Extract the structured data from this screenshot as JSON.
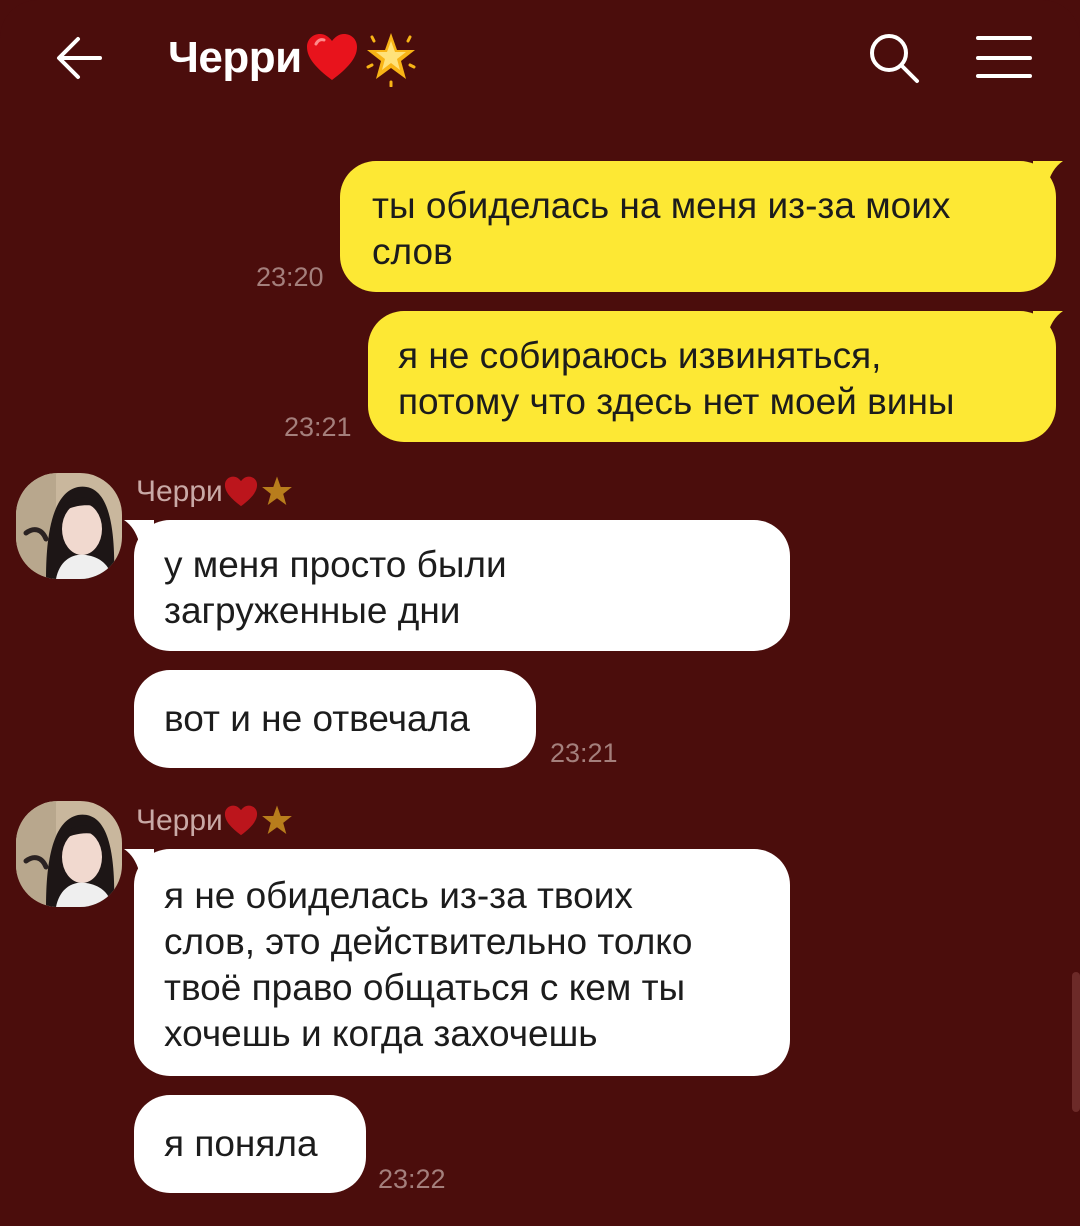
{
  "header": {
    "title": "Черри",
    "title_emoji": [
      "heart-emoji",
      "star-emoji"
    ],
    "back_icon": "arrow-left-icon",
    "search_icon": "search-icon",
    "menu_icon": "hamburger-menu-icon"
  },
  "colors": {
    "background": "#4b0d0c",
    "my_bubble": "#fde834",
    "their_bubble": "#ffffff",
    "timestamp": "#a47f7c"
  },
  "messages": [
    {
      "from": "me",
      "text_lines": [
        "ты обиделась на меня из-за моих",
        "слов"
      ],
      "time": "23:20"
    },
    {
      "from": "me",
      "text_lines": [
        "я не собираюсь извиняться,",
        "потому что здесь нет моей вины"
      ],
      "time": "23:21"
    },
    {
      "from": "them",
      "sender": "Черри",
      "text_lines": [
        "у меня просто были",
        "загруженные дни"
      ]
    },
    {
      "from": "them",
      "text_lines": [
        "вот и не отвечала"
      ],
      "time": "23:21"
    },
    {
      "from": "them",
      "sender": "Черри",
      "text_lines": [
        "я не обиделась из-за твоих",
        "слов, это действительно толко",
        "твоё право общаться с кем ты",
        "хочешь и когда захочешь"
      ]
    },
    {
      "from": "them",
      "text_lines": [
        "я поняла"
      ],
      "time": "23:22"
    }
  ]
}
